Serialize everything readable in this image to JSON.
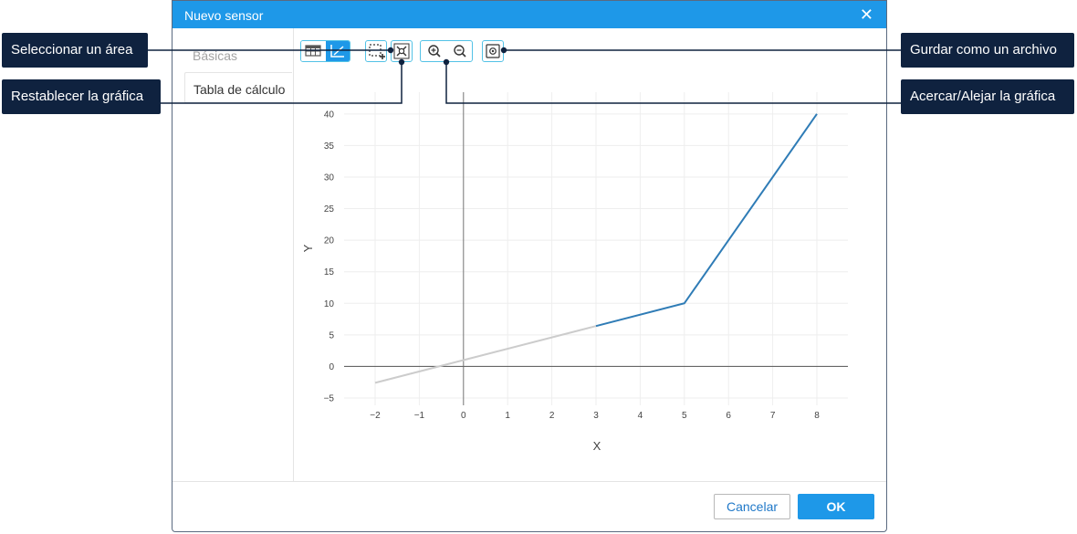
{
  "dialog": {
    "title": "Nuevo sensor",
    "close_icon": "close-icon",
    "tabs": [
      "Básicas",
      "Tabla de cálculo"
    ],
    "footer": {
      "cancel_label": "Cancelar",
      "ok_label": "OK"
    }
  },
  "toolbar": {
    "icons": [
      "table-view-icon",
      "chart-view-icon",
      "select-area-icon",
      "reset-chart-icon",
      "zoom-in-icon",
      "zoom-out-icon",
      "save-file-icon"
    ],
    "accent": "#1e98e8",
    "border": "#53c2e6"
  },
  "callouts": {
    "select_area": "Seleccionar un área",
    "reset_chart": "Restablecer la gráfica",
    "save_file": "Gurdar como un archivo",
    "zoom": "Acercar/Alejar la gráfica"
  },
  "chart_data": {
    "type": "line",
    "xlabel": "X",
    "ylabel": "Y",
    "xlim": [
      -2,
      8
    ],
    "ylim": [
      -5,
      40
    ],
    "x_ticks": [
      "−2",
      "−1",
      "0",
      "1",
      "2",
      "3",
      "4",
      "5",
      "6",
      "7",
      "8"
    ],
    "y_ticks": [
      "40",
      "35",
      "30",
      "25",
      "20",
      "15",
      "10",
      "5",
      "0",
      "−5"
    ],
    "grid": true,
    "extrapolated_segment": {
      "color": "#cccccc",
      "points": [
        [
          -2,
          -2.6
        ],
        [
          3,
          6.4
        ]
      ]
    },
    "series": [
      {
        "color": "#2f7cb6",
        "points": [
          [
            3,
            6.4
          ],
          [
            5,
            10
          ],
          [
            8,
            40
          ]
        ]
      }
    ]
  }
}
